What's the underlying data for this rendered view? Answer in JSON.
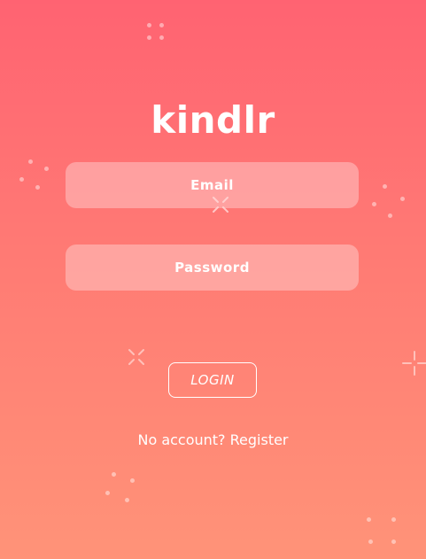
{
  "app": {
    "brand": "kindlr"
  },
  "form": {
    "email_placeholder": "Email",
    "password_placeholder": "Password",
    "login_label": "LOGIN",
    "register_text": "No account? Register"
  },
  "theme": {
    "gradient_top": "#ff6372",
    "gradient_bottom": "#ff9378",
    "field_fill": "rgba(255,214,214,0.45)",
    "text": "#ffffff"
  },
  "decorations": {
    "icons": [
      "dot-cluster-icon",
      "sparkle-x-icon",
      "sparkle-plus-icon"
    ]
  }
}
